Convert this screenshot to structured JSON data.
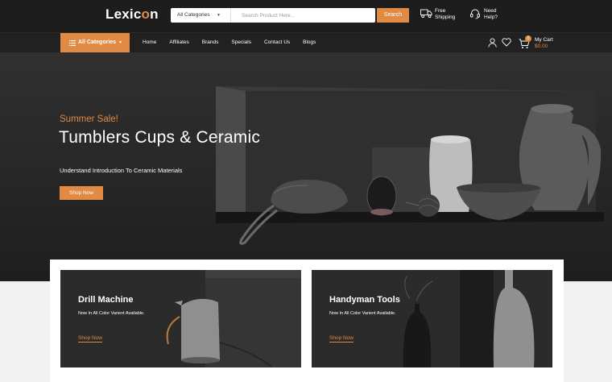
{
  "header": {
    "logo": {
      "text_before": "Lexic",
      "text_mark": "o",
      "text_after": "n"
    },
    "search": {
      "category_label": "All Categories",
      "placeholder": "Search Product Here...",
      "button_label": "Search"
    },
    "shipping": {
      "line1": "Free",
      "line2": "Shipping"
    },
    "help": {
      "line1": "Need",
      "line2": "Help?"
    }
  },
  "nav": {
    "all_categories": "All Categories",
    "items": [
      "Home",
      "Affiliates",
      "Brands",
      "Specials",
      "Contact Us",
      "Blogs"
    ],
    "cart": {
      "label": "My Cart",
      "amount": "$0.00",
      "count": "0"
    }
  },
  "hero": {
    "subtitle": "Summer Sale!",
    "title": "Tumblers Cups & Ceramic",
    "description": "Understand Introduction To Ceramic Materials",
    "button": "Shop Now"
  },
  "banners": [
    {
      "title": "Drill Machine",
      "subtitle": "Now In All Color Varient Available.",
      "link": "Shop Now"
    },
    {
      "title": "Handyman Tools",
      "subtitle": "Now In All Color Varient Available.",
      "link": "Shop Now"
    }
  ],
  "colors": {
    "accent": "#e08a44",
    "header_bg": "#1d1d1d",
    "hero_bg": "#2a2a2a"
  },
  "icons": [
    "chevron-down-icon",
    "truck-icon",
    "headset-icon",
    "menu-icon",
    "user-icon",
    "heart-icon",
    "cart-icon"
  ]
}
